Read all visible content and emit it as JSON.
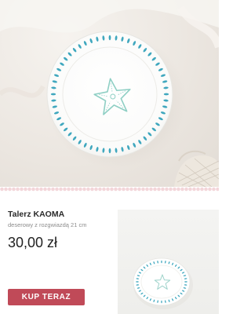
{
  "hero": {
    "image": "starfish-plate-photo",
    "plate_rim_dot_color": "#3fa7be",
    "starfish_color": "#8ecfc4"
  },
  "divider": {
    "pattern": "scalloped-edge",
    "color": "#f3d6da"
  },
  "product": {
    "name": "Talerz KAOMA",
    "description": "deserowy z rozgwiazdą 21 cm",
    "price": "30,00 zł",
    "thumbnail": "starfish-plate-thumbnail"
  },
  "cta": {
    "label": "KUP TERAZ",
    "color": "#c04a58"
  }
}
